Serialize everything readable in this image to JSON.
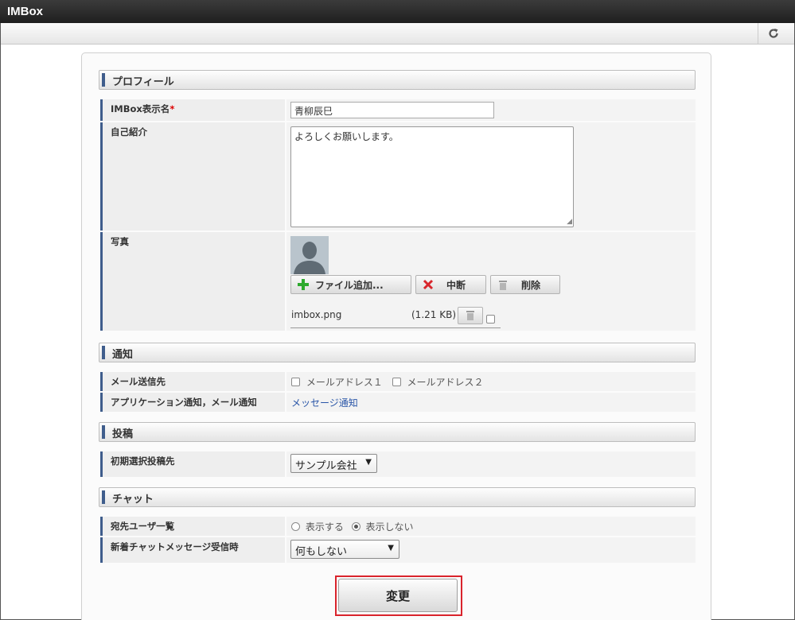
{
  "app": {
    "title": "IMBox"
  },
  "sections": {
    "profile": "プロフィール",
    "notify": "通知",
    "post": "投稿",
    "chat": "チャット"
  },
  "profile": {
    "display_name_label": "IMBox表示名",
    "required_mark": "*",
    "display_name_value": "青柳辰巳",
    "intro_label": "自己紹介",
    "intro_value": "よろしくお願いします。",
    "photo_label": "写真",
    "add_file_label": "ファイル追加...",
    "abort_label": "中断",
    "delete_label": "削除",
    "file_name": "imbox.png",
    "file_size": "(1.21 KB)"
  },
  "notify": {
    "mail_to_label": "メール送信先",
    "mail1": "メールアドレス１",
    "mail2": "メールアドレス２",
    "app_notify_label": "アプリケーション通知，メール通知",
    "message_link": "メッセージ通知"
  },
  "post": {
    "default_target_label": "初期選択投稿先",
    "default_target_value": "サンプル会社"
  },
  "chat": {
    "recipients_label": "宛先ユーザ一覧",
    "show_label": "表示する",
    "hide_label": "表示しない",
    "selected": "表示しない",
    "incoming_label": "新着チャットメッセージ受信時",
    "incoming_value": "何もしない"
  },
  "submit_label": "変更",
  "colors": {
    "accent": "#3f5d8c",
    "highlight": "#d9232c",
    "link": "#2a56a8"
  }
}
